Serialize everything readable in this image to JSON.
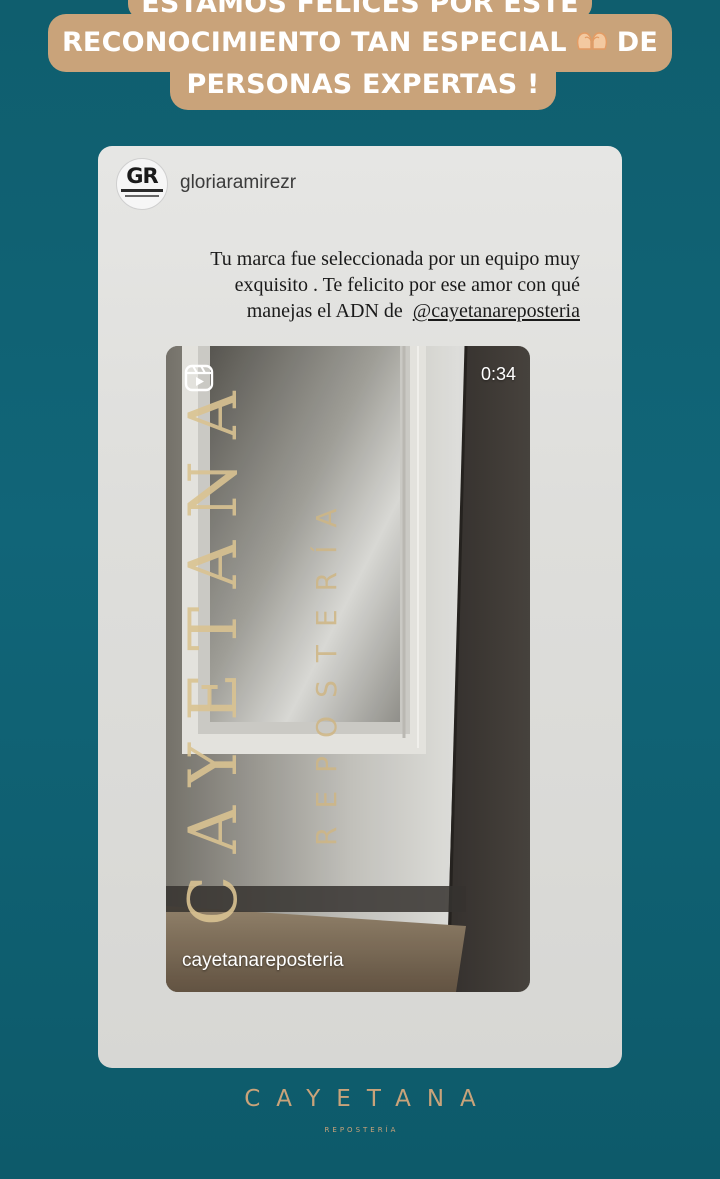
{
  "caption": {
    "line1": "ESTAMOS FELICES POR ESTE",
    "line2_start": "RECONOCIMIENTO TAN ESPECIAL",
    "line2_end": "DE",
    "line3": "PERSONAS EXPERTAS !",
    "emoji_icon": "heart-hands-icon",
    "pill_color": "#c9a37a"
  },
  "shared_post": {
    "username": "gloriaramirezr",
    "avatar_initials": "GR",
    "message_lines": [
      "Tu marca fue seleccionada por  un equipo  muy",
      "exquisito  . Te felicito por ese amor con qué",
      "manejas el ADN de"
    ],
    "mention": "@cayetanareposteria"
  },
  "reel": {
    "icon": "reels-icon",
    "duration": "0:34",
    "account": "cayetanareposteria"
  },
  "footer": {
    "brand": "CAYETANA",
    "brand_sub": "REPOSTERÍA",
    "brand_color": "#c9a37a"
  },
  "background_color": "#0f5e6e"
}
